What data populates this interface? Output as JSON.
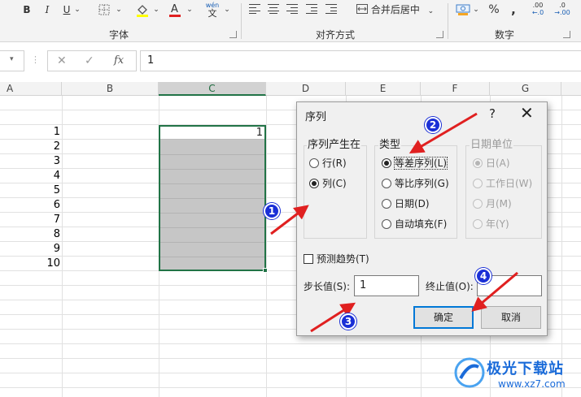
{
  "ribbon": {
    "bold_label": "B",
    "italic_label": "I",
    "underline_label": "U",
    "phonetic_top": "wén",
    "phonetic_bottom": "文",
    "font_group_label": "字体",
    "alignment_group_label": "对齐方式",
    "merge_center_label": "合并后居中",
    "percent_label": "%",
    "comma_label": ",",
    "number_group_label": "数字",
    "dec_inc_label": ".00",
    "dec_dec_label": ".0"
  },
  "formula_bar": {
    "value": "1"
  },
  "columns": [
    "A",
    "B",
    "C",
    "D",
    "E",
    "F",
    "G"
  ],
  "rows": [
    "1",
    "2",
    "3",
    "4",
    "5",
    "6",
    "7",
    "8",
    "9",
    "10"
  ],
  "cells": {
    "C1": "1"
  },
  "dialog": {
    "title": "序列",
    "help": "?",
    "close": "✕",
    "series_in": {
      "title": "序列产生在",
      "options": [
        {
          "label": "行(R)",
          "selected": false
        },
        {
          "label": "列(C)",
          "selected": true
        }
      ]
    },
    "type": {
      "title": "类型",
      "options": [
        {
          "label": "等差序列(L)",
          "selected": true
        },
        {
          "label": "等比序列(G)",
          "selected": false
        },
        {
          "label": "日期(D)",
          "selected": false
        },
        {
          "label": "自动填充(F)",
          "selected": false
        }
      ]
    },
    "date_unit": {
      "title": "日期单位",
      "options": [
        {
          "label": "日(A)",
          "selected": true
        },
        {
          "label": "工作日(W)",
          "selected": false
        },
        {
          "label": "月(M)",
          "selected": false
        },
        {
          "label": "年(Y)",
          "selected": false
        }
      ]
    },
    "trend_label": "预测趋势(T)",
    "step_label": "步长值(S):",
    "step_value": "1",
    "stop_label": "终止值(O):",
    "stop_value": "",
    "ok_label": "确定",
    "cancel_label": "取消"
  },
  "annotations": {
    "badges": [
      "1",
      "2",
      "3",
      "4"
    ],
    "arrow_color": "#e02020",
    "badge_color": "#1a2fd6"
  },
  "watermark": {
    "brand": "极光下载站",
    "url": "www.xz7.com"
  },
  "colors": {
    "excel_green": "#217346",
    "selection_fill": "#c6c6c6",
    "dialog_bg": "#f0f0f0",
    "ok_border": "#0078d7"
  }
}
